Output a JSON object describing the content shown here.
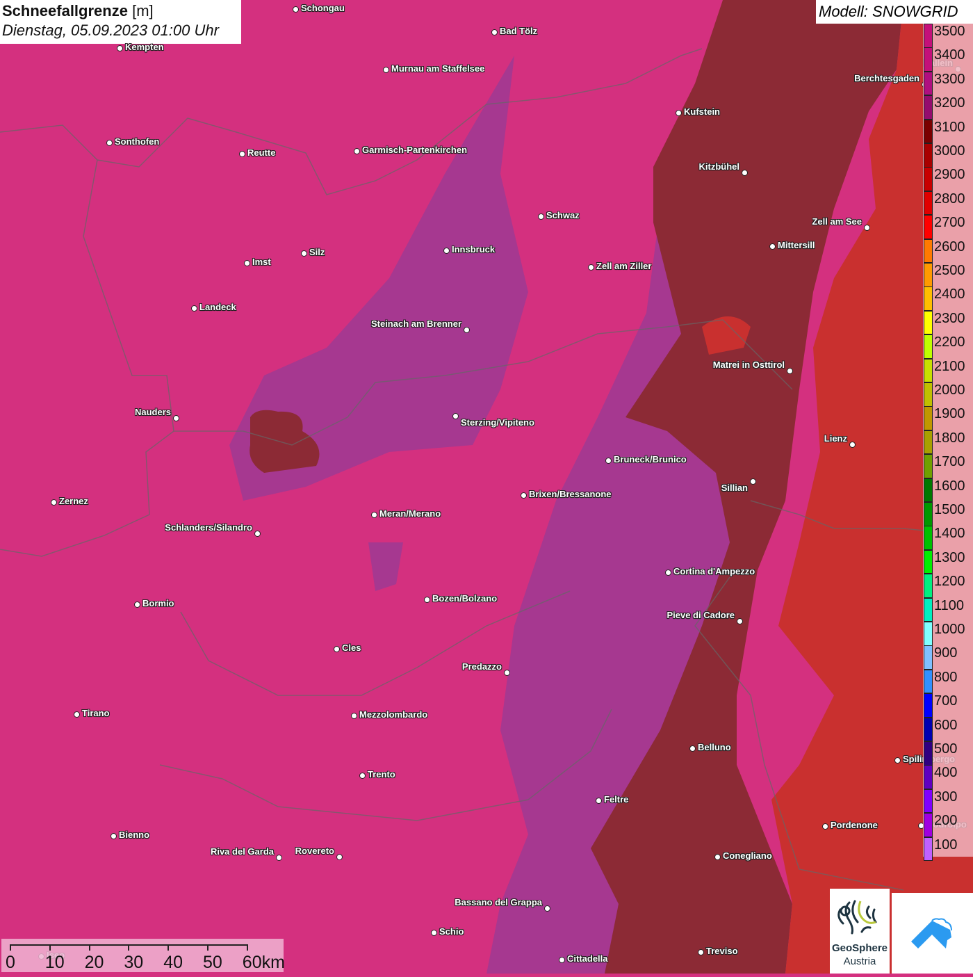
{
  "header": {
    "title": "Schneefallgrenze",
    "unit": "[m]",
    "datetime": "Dienstag, 05.09.2023 01:00 Uhr",
    "model": "Modell: SNOWGRID"
  },
  "legend": {
    "items": [
      {
        "label": "3500",
        "color": "#c4107a"
      },
      {
        "label": "3400",
        "color": "#c4107a"
      },
      {
        "label": "3300",
        "color": "#b00f80"
      },
      {
        "label": "3200",
        "color": "#940c6e"
      },
      {
        "label": "3100",
        "color": "#7a0000"
      },
      {
        "label": "3000",
        "color": "#a80000"
      },
      {
        "label": "2900",
        "color": "#c80000"
      },
      {
        "label": "2800",
        "color": "#e00000"
      },
      {
        "label": "2700",
        "color": "#ff0000"
      },
      {
        "label": "2600",
        "color": "#ff7a00"
      },
      {
        "label": "2500",
        "color": "#ff9a00"
      },
      {
        "label": "2400",
        "color": "#ffbe00"
      },
      {
        "label": "2300",
        "color": "#ffff00"
      },
      {
        "label": "2200",
        "color": "#c0ff00"
      },
      {
        "label": "2100",
        "color": "#c8e000"
      },
      {
        "label": "2000",
        "color": "#c0c000"
      },
      {
        "label": "1900",
        "color": "#c09800"
      },
      {
        "label": "1800",
        "color": "#a8a000"
      },
      {
        "label": "1700",
        "color": "#70a000"
      },
      {
        "label": "1600",
        "color": "#007800"
      },
      {
        "label": "1500",
        "color": "#009800"
      },
      {
        "label": "1400",
        "color": "#00c000"
      },
      {
        "label": "1300",
        "color": "#00f000"
      },
      {
        "label": "1200",
        "color": "#00f080"
      },
      {
        "label": "1100",
        "color": "#00f0c0"
      },
      {
        "label": "1000",
        "color": "#80ffff"
      },
      {
        "label": "900",
        "color": "#80c0ff"
      },
      {
        "label": "800",
        "color": "#3090ff"
      },
      {
        "label": "700",
        "color": "#0000ff"
      },
      {
        "label": "600",
        "color": "#0000b0"
      },
      {
        "label": "500",
        "color": "#300080"
      },
      {
        "label": "400",
        "color": "#6000c0"
      },
      {
        "label": "300",
        "color": "#8000ff"
      },
      {
        "label": "200",
        "color": "#a000e0"
      },
      {
        "label": "100",
        "color": "#c060ff"
      }
    ]
  },
  "map_colors": {
    "pink": "#d4307f",
    "purple": "#a63890",
    "maroon": "#8c2a35",
    "red": "#c9302f"
  },
  "cities": [
    "Schongau",
    "Bad Tölz",
    "Kempten",
    "Murnau am Staffelsee",
    "Kufstein",
    "Berchtesgaden",
    "Hallein",
    "Kitzbühel",
    "Sonthofen",
    "Reutte",
    "Garmisch-Partenkirchen",
    "Schwaz",
    "Zell am See",
    "Innsbruck",
    "Mittersill",
    "Silz",
    "Imst",
    "Zell am Ziller",
    "Landeck",
    "Steinach am Brenner",
    "Matrei in Osttirol",
    "Nauders",
    "Sterzing/Vipiteno",
    "Lienz",
    "Bruneck/Brunico",
    "Sillian",
    "Brixen/Bressanone",
    "Zernez",
    "Meran/Merano",
    "Schlanders/Silandro",
    "Cortina d'Ampezzo",
    "Bormio",
    "Bozen/Bolzano",
    "Pieve di Cadore",
    "Cles",
    "Predazzo",
    "Tirano",
    "Mezzolombardo",
    "Belluno",
    "Spilimbergo",
    "Trento",
    "Feltre",
    "Pordenone",
    "Codroipo",
    "Bienno",
    "Riva del Garda",
    "Rovereto",
    "Conegliano",
    "Bassano del Grappa",
    "Schio",
    "Treviso",
    "Cittadella",
    "Iseo"
  ],
  "scale": {
    "labels": [
      "0",
      "10",
      "20",
      "30",
      "40",
      "50",
      "60km"
    ]
  },
  "logos": {
    "geosphere_line1": "GeoSphere",
    "geosphere_line2": "Austria"
  }
}
